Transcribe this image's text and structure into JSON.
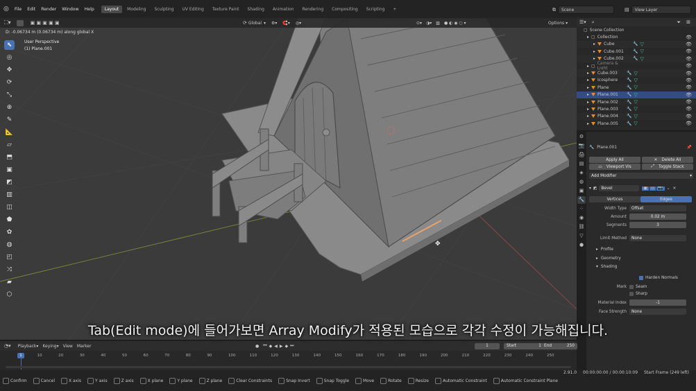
{
  "topbar": {
    "menus": [
      "File",
      "Edit",
      "Render",
      "Window",
      "Help"
    ],
    "workspaces": [
      "Layout",
      "Modeling",
      "Sculpting",
      "UV Editing",
      "Texture Paint",
      "Shading",
      "Animation",
      "Rendering",
      "Compositing",
      "Scripting"
    ],
    "active_workspace": "Layout",
    "plus": "+",
    "scene_label": "Scene",
    "view_layer_label": "View Layer"
  },
  "viewport": {
    "orientation": "Global",
    "options_label": "Options",
    "status_line": "D: -0.06734 m (0.06734 m) along global X",
    "view_name": "User Perspective",
    "object_name": "(1) Plane.001",
    "subtitle": "Tab(Edit mode)에 들어가보면 Array Modify가 적용된 모습으로 각각 수정이 가능해집니다."
  },
  "outliner": {
    "header": "Scene Collection",
    "rows": [
      {
        "label": "Collection",
        "indent": 1,
        "type": "collection"
      },
      {
        "label": "Cube",
        "indent": 2,
        "type": "mesh"
      },
      {
        "label": "Cube.001",
        "indent": 2,
        "type": "mesh"
      },
      {
        "label": "Cube.002",
        "indent": 2,
        "type": "mesh"
      },
      {
        "label": "Camera & Light",
        "indent": 1,
        "type": "collection-dim"
      },
      {
        "label": "Cube.003",
        "indent": 1,
        "type": "mesh"
      },
      {
        "label": "Icosphere",
        "indent": 1,
        "type": "mesh"
      },
      {
        "label": "Plane",
        "indent": 1,
        "type": "mesh"
      },
      {
        "label": "Plane.001",
        "indent": 1,
        "type": "mesh",
        "selected": true
      },
      {
        "label": "Plane.002",
        "indent": 1,
        "type": "mesh"
      },
      {
        "label": "Plane.003",
        "indent": 1,
        "type": "mesh"
      },
      {
        "label": "Plane.004",
        "indent": 1,
        "type": "mesh"
      },
      {
        "label": "Plane.005",
        "indent": 1,
        "type": "mesh"
      }
    ]
  },
  "properties": {
    "object_name": "Plane.001",
    "apply_all": "Apply All",
    "delete_all": "Delete All",
    "viewport_vis": "Viewport Vis",
    "toggle_stack": "Toggle Stack",
    "add_modifier": "Add Modifier",
    "modifier_name": "Bevel",
    "mode_vertices": "Vertices",
    "mode_edges": "Edges",
    "width_type_label": "Width Type",
    "width_type_value": "Offset",
    "amount_label": "Amount",
    "amount_value": "0.02 m",
    "segments_label": "Segments",
    "segments_value": "3",
    "limit_method_label": "Limit Method",
    "limit_method_value": "None",
    "profile_label": "Profile",
    "geometry_label": "Geometry",
    "shading_label": "Shading",
    "harden_normals_label": "Harden Normals",
    "mark_label": "Mark",
    "seam_label": "Seam",
    "sharp_label": "Sharp",
    "material_index_label": "Material Index",
    "material_index_value": "-1",
    "face_strength_label": "Face Strength",
    "face_strength_value": "None"
  },
  "timeline": {
    "menus": [
      "Playback",
      "Keying",
      "View",
      "Marker"
    ],
    "current_frame": "1",
    "start_label": "Start",
    "start_value": "1",
    "end_label": "End",
    "end_value": "250",
    "ticks": [
      "10",
      "20",
      "30",
      "40",
      "50",
      "60",
      "70",
      "80",
      "90",
      "100",
      "110",
      "120",
      "130",
      "140",
      "150",
      "160",
      "170",
      "180",
      "190",
      "200",
      "210",
      "220",
      "230",
      "240",
      "250"
    ],
    "playhead": "1"
  },
  "statusbar": {
    "items": [
      "Confirm",
      "Cancel",
      "X axis",
      "Y axis",
      "Z axis",
      "X plane",
      "Y plane",
      "Z plane",
      "Clear Constraints",
      "Snap Invert",
      "Snap Toggle",
      "Move",
      "Rotate",
      "Resize",
      "Automatic Constraint",
      "Automatic Constraint Plane"
    ],
    "version": "2.91.0",
    "time": "00:00:00:00 / 00:00:10:09",
    "start_frame": "Start Frame (249 left)"
  },
  "colors": {
    "accent_blue": "#4772b3",
    "mesh_orange": "#e88a2e",
    "selection_blue": "#334d80",
    "viewport_bg": "#3b3b3b"
  }
}
